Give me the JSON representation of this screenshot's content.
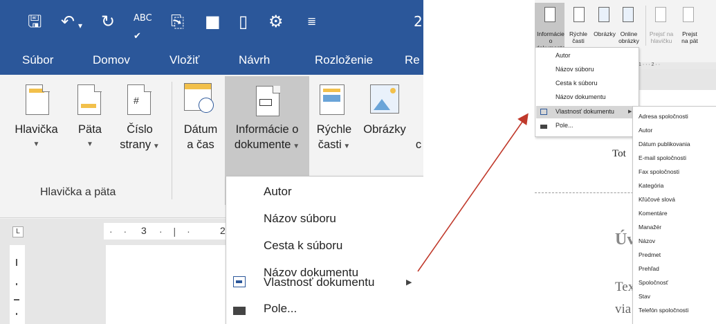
{
  "qat": {
    "page_num": "2"
  },
  "tabs": [
    "Súbor",
    "Domov",
    "Vložiť",
    "Návrh",
    "Rozloženie",
    "Re"
  ],
  "ribbon": {
    "header_line1": "Hlavička",
    "footer_line1": "Päta",
    "pagenum_line1": "Číslo",
    "pagenum_line2": "strany",
    "datetime_line1": "Dátum",
    "datetime_line2": "a čas",
    "docinfo_line1": "Informácie o",
    "docinfo_line2": "dokumente",
    "quickparts_line1": "Rýchle",
    "quickparts_line2": "časti",
    "pictures_line1": "Obrázky",
    "group_label": "Hlavička a päta",
    "extra_char": "c"
  },
  "ruler": {
    "mark1": "3",
    "mark2": "2"
  },
  "menu_big": [
    "Autor",
    "Názov súboru",
    "Cesta k súboru",
    "Názov dokumentu",
    "Vlastnosť dokumentu",
    "Pole..."
  ],
  "right": {
    "buttons": [
      {
        "l1": "Informácie o",
        "l2": "dokumente"
      },
      {
        "l1": "Rýchle",
        "l2": "časti"
      },
      {
        "l1": "Obrázky",
        "l2": ""
      },
      {
        "l1": "Online",
        "l2": "obrázky"
      },
      {
        "l1": "Prejsť na",
        "l2": "hlavičku"
      },
      {
        "l1": "Prejst",
        "l2": "na pät"
      }
    ],
    "menu": [
      "Autor",
      "Názov súboru",
      "Cesta k súboru",
      "Názov dokumentu",
      "Vlastnosť dokumentu",
      "Pole..."
    ],
    "submenu": [
      "Adresa spoločnosti",
      "Autor",
      "Dátum publikovania",
      "E-mail spoločnosti",
      "Fax spoločnosti",
      "Kategória",
      "Kľúčové slová",
      "Komentáre",
      "Manažér",
      "Názov",
      "Predmet",
      "Prehľad",
      "Spoločnosť",
      "Stav",
      "Telefón spoločnosti"
    ],
    "doc_tot": "Tot",
    "doc_heading": "Úv",
    "doc_tex": "Tex",
    "doc_via": "via",
    "ruler_digits": "1 · · · 2 · ·"
  },
  "colors": {
    "word_blue": "#2b579a",
    "arrow": "#c0392b",
    "selected": "#c8c8c8"
  }
}
